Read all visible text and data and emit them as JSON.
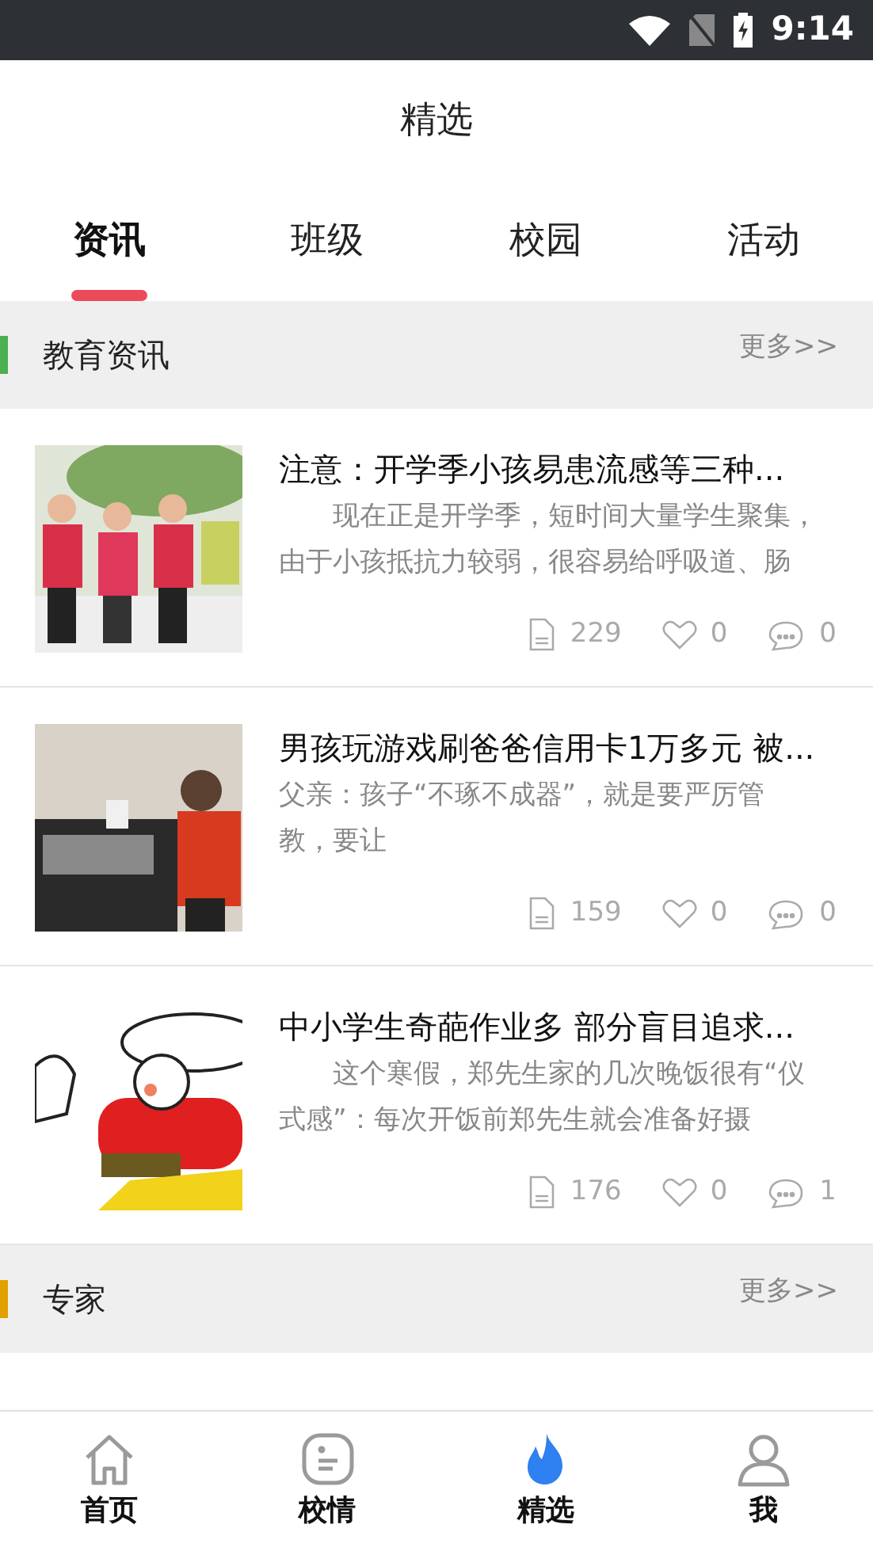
{
  "status_bar": {
    "time": "9:14"
  },
  "header": {
    "title": "精选"
  },
  "tabs": [
    {
      "label": "资讯",
      "selected": true
    },
    {
      "label": "班级",
      "selected": false
    },
    {
      "label": "校园",
      "selected": false
    },
    {
      "label": "活动",
      "selected": false
    }
  ],
  "sections": [
    {
      "title": "教育资讯",
      "more": "更多>>",
      "color": "#4caf50",
      "articles": [
        {
          "title": "注意：开学季小孩易患流感等三种...",
          "summary": "现在正是开学季，短时间大量学生聚集，由于小孩抵抗力较弱，很容易给呼吸道、肠",
          "indented": true,
          "views": "229",
          "likes": "0",
          "comments": "0"
        },
        {
          "title": "男孩玩游戏刷爸爸信用卡1万多元 被...",
          "summary": "父亲：孩子“不琢不成器”，就是要严厉管教，要让",
          "indented": false,
          "views": "159",
          "likes": "0",
          "comments": "0"
        },
        {
          "title": "中小学生奇葩作业多 部分盲目追求...",
          "summary": "这个寒假，郑先生家的几次晚饭很有“仪式感”：每次开饭前郑先生就会准备好摄",
          "indented": true,
          "views": "176",
          "likes": "0",
          "comments": "1"
        }
      ]
    },
    {
      "title": "专家",
      "more": "更多>>",
      "color": "#e0a000"
    }
  ],
  "bottom_nav": [
    {
      "label": "首页",
      "kind": "home",
      "selected": false
    },
    {
      "label": "校情",
      "kind": "chat",
      "selected": false
    },
    {
      "label": "精选",
      "kind": "flame",
      "selected": true
    },
    {
      "label": "我",
      "kind": "person",
      "selected": false
    }
  ]
}
